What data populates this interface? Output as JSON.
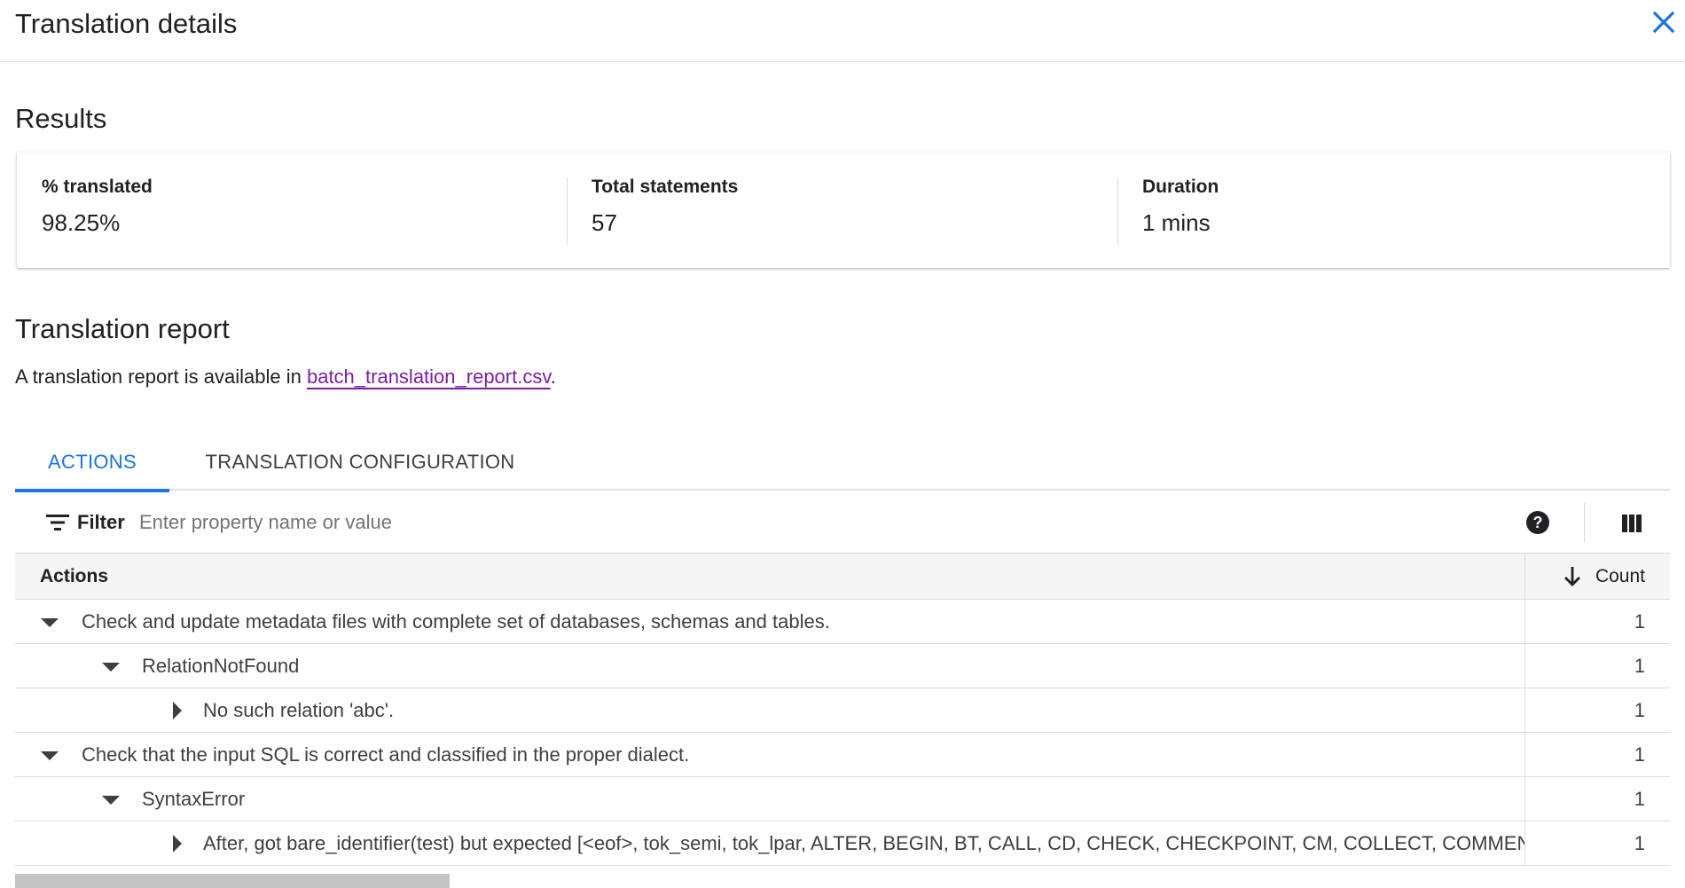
{
  "header": {
    "title": "Translation details",
    "close_icon": "close-icon",
    "accent_color": "#1a73e8"
  },
  "results": {
    "title": "Results",
    "metrics": [
      {
        "label": "% translated",
        "value": "98.25%"
      },
      {
        "label": "Total statements",
        "value": "57"
      },
      {
        "label": "Duration",
        "value": "1 mins"
      }
    ]
  },
  "report": {
    "title": "Translation report",
    "description_prefix": "A translation report is available in ",
    "link_text": "batch_translation_report.csv",
    "description_suffix": "."
  },
  "tabs": [
    {
      "label": "ACTIONS",
      "selected": true
    },
    {
      "label": "TRANSLATION CONFIGURATION",
      "selected": false
    }
  ],
  "filter": {
    "label": "Filter",
    "placeholder": "Enter property name or value",
    "filter_icon": "filter-list-icon",
    "help_icon": "help-icon",
    "columns_icon": "column-display-icon"
  },
  "table": {
    "columns": {
      "actions": "Actions",
      "count": "Count"
    },
    "sort": "descending",
    "rows": [
      {
        "level": 0,
        "expanded": true,
        "text": "Check and update metadata files with complete set of databases, schemas and tables.",
        "count": "1"
      },
      {
        "level": 1,
        "expanded": true,
        "text": "RelationNotFound",
        "count": "1"
      },
      {
        "level": 2,
        "expanded": false,
        "text": "No such relation 'abc'.",
        "count": "1"
      },
      {
        "level": 0,
        "expanded": true,
        "text": "Check that the input SQL is correct and classified in the proper dialect.",
        "count": "1"
      },
      {
        "level": 1,
        "expanded": true,
        "text": "SyntaxError",
        "count": "1"
      },
      {
        "level": 2,
        "expanded": false,
        "text": "After, got bare_identifier(test) but expected [<eof>, tok_semi, tok_lpar, ALTER, BEGIN, BT, CALL, CD, CHECK, CHECKPOINT, CM, COLLECT, COMMENT, CO",
        "count": "1"
      }
    ]
  }
}
